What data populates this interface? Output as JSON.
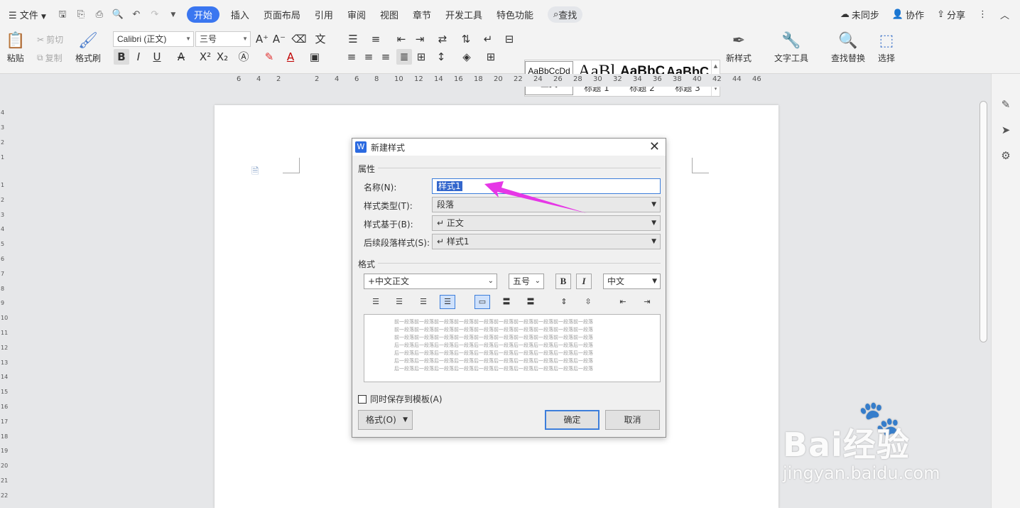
{
  "menubar": {
    "file": "文件",
    "tabs": [
      "开始",
      "插入",
      "页面布局",
      "引用",
      "审阅",
      "视图",
      "章节",
      "开发工具",
      "特色功能"
    ],
    "search": "查找",
    "sync": "未同步",
    "collab": "协作",
    "share": "分享"
  },
  "ribbon": {
    "paste": "粘贴",
    "cut": "剪切",
    "copy": "复制",
    "format_painter": "格式刷",
    "font_name": "Calibri (正文)",
    "font_size": "三号",
    "styles": [
      {
        "preview": "AaBbCcDd",
        "label": "正文"
      },
      {
        "preview": "AaBl",
        "label": "标题 1"
      },
      {
        "preview": "AaBbC",
        "label": "标题 2"
      },
      {
        "preview": "AaBbC",
        "label": "标题 3"
      }
    ],
    "new_style": "新样式",
    "text_tools": "文字工具",
    "find_replace": "查找替换",
    "select": "选择"
  },
  "ruler": {
    "top_numbers": [
      "6",
      "4",
      "2",
      "2",
      "4",
      "6",
      "8",
      "10",
      "12",
      "14",
      "16",
      "18",
      "20",
      "22",
      "24",
      "26",
      "28",
      "30",
      "32",
      "34",
      "36",
      "38",
      "40",
      "42",
      "44",
      "46"
    ],
    "left_numbers": [
      "4",
      "3",
      "2",
      "1",
      "1",
      "2",
      "3",
      "4",
      "5",
      "6",
      "7",
      "8",
      "9",
      "10",
      "11",
      "12",
      "13",
      "14",
      "15",
      "16",
      "17",
      "18",
      "19",
      "20",
      "21",
      "22"
    ]
  },
  "dialog": {
    "title": "新建样式",
    "section_props": "属性",
    "name_label": "名称(N):",
    "name_value": "样式1",
    "type_label": "样式类型(T):",
    "type_value": "段落",
    "based_label": "样式基于(B):",
    "based_value": "↵ 正文",
    "next_label": "后续段落样式(S):",
    "next_value": "↵ 样式1",
    "section_format": "格式",
    "font": "+中文正文",
    "size": "五号",
    "bold": "B",
    "italic": "I",
    "lang": "中文",
    "preview_prev": "前一段落前一段落前一段落前一段落前一段落前一段落前一段落前一段落前一段落前一段落",
    "preview_next": "后一段落后一段落后一段落后一段落后一段落后一段落后一段落后一段落后一段落后一段落",
    "save_template": "同时保存到模板(A)",
    "format_button": "格式(O)",
    "ok": "确定",
    "cancel": "取消"
  },
  "watermark": {
    "brand": "Bai经验",
    "site": "jingyan.baidu.com"
  },
  "colors": {
    "accent": "#3a76f0",
    "arrow": "#e637e6",
    "selection": "#3366cc"
  }
}
